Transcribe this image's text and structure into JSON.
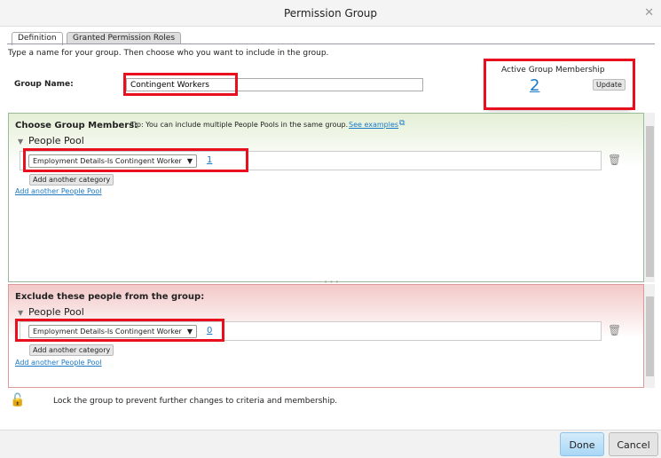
{
  "dialog": {
    "title": "Permission Group"
  },
  "tabs": [
    {
      "label": "Definition"
    },
    {
      "label": "Granted Permission Roles"
    }
  ],
  "instruction": "Type a name for your group. Then choose who you want to include in the group.",
  "group_name": {
    "label": "Group Name:",
    "value": "Contingent Workers"
  },
  "membership": {
    "label": "Active Group Membership",
    "count": "2",
    "update_label": "Update"
  },
  "include": {
    "heading": "Choose Group Members:",
    "tip": "Tip: You can include multiple People Pools in the same group.",
    "see_examples": "See examples",
    "pool_label": "People Pool",
    "category": "Employment Details-Is Contingent Worker",
    "count": "1",
    "add_category": "Add another category",
    "add_pool": "Add another People Pool"
  },
  "exclude": {
    "heading": "Exclude these people from the group:",
    "pool_label": "People Pool",
    "category": "Employment Details-Is Contingent Worker",
    "count": "0",
    "add_category": "Add another category",
    "add_pool": "Add another People Pool"
  },
  "lock_text": "Lock the group to prevent further changes to criteria and membership.",
  "footer": {
    "done": "Done",
    "cancel": "Cancel"
  },
  "colors": {
    "highlight": "#e8101e",
    "link": "#1a7ac8"
  }
}
